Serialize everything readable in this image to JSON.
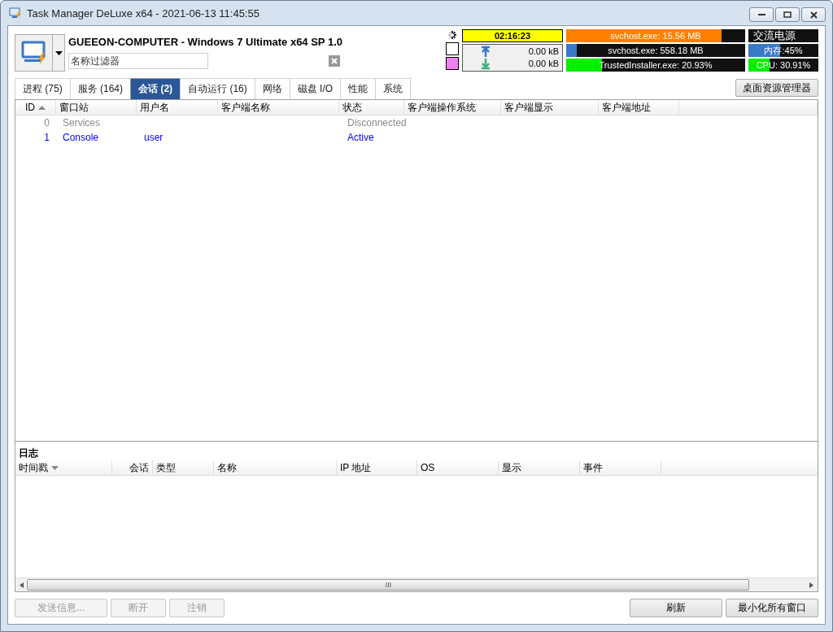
{
  "window": {
    "title": "Task Manager DeLuxe x64 - 2021-06-13 11:45:55"
  },
  "header": {
    "computer": "GUEEON-COMPUTER - Windows 7 Ultimate x64 SP 1.0",
    "filter": {
      "placeholder": "名称过滤器"
    }
  },
  "status": {
    "uptime": "02:16:23",
    "net_up": "0.00 kB",
    "net_down": "0.00 kB",
    "meters": [
      {
        "text": "svchost.exe: 15.56 MB",
        "level": 0.87,
        "color": "#ff8000"
      },
      {
        "text": "交流电源"
      },
      {
        "text": "svchost.exe: 558.18 MB",
        "level": 0.06,
        "color": "#3a78c8"
      },
      {
        "text": "内存:45%",
        "level": 0.45,
        "color": "#3a78c8"
      },
      {
        "text": "TrustedInstaller.exe: 20.93%",
        "level": 0.2,
        "color": "#00f000"
      },
      {
        "text": "CPU: 30.91%",
        "level": 0.3,
        "color": "#00f000"
      }
    ]
  },
  "tabs": [
    {
      "label": "进程 (75)",
      "selected": false
    },
    {
      "label": "服务 (164)",
      "selected": false
    },
    {
      "label": "会话 (2)",
      "selected": true
    },
    {
      "label": "自动运行 (16)",
      "selected": false
    },
    {
      "label": "网络",
      "selected": false
    },
    {
      "label": "磁盘 I/O",
      "selected": false
    },
    {
      "label": "性能",
      "selected": false
    },
    {
      "label": "系统",
      "selected": false
    }
  ],
  "desktop_button": "桌面资源管理器",
  "table": {
    "columns": [
      {
        "label": "ID",
        "sort_up": true
      },
      {
        "label": "窗口站"
      },
      {
        "label": "用户名"
      },
      {
        "label": "客户端名称"
      },
      {
        "label": "状态"
      },
      {
        "label": "客户端操作系统"
      },
      {
        "label": "客户端显示"
      },
      {
        "label": "客户端地址"
      }
    ],
    "rows": [
      {
        "id": "0",
        "station": "Services",
        "state": "Disconnected",
        "disabled": true
      },
      {
        "id": "1",
        "station": "Console",
        "user": "user",
        "state": "Active",
        "disabled": false
      }
    ]
  },
  "log": {
    "title": "日志",
    "columns": [
      {
        "label": "时间戳",
        "sort_down": true
      },
      {
        "label": "会话"
      },
      {
        "label": "类型"
      },
      {
        "label": "名称"
      },
      {
        "label": "IP 地址"
      },
      {
        "label": "OS"
      },
      {
        "label": "显示"
      },
      {
        "label": "事件"
      }
    ]
  },
  "buttons_left": [
    {
      "label": "发送信息...",
      "disabled": true
    },
    {
      "label": "断开",
      "disabled": true
    },
    {
      "label": "注销",
      "disabled": true
    }
  ],
  "buttons_right": [
    {
      "label": "刷新",
      "disabled": false
    },
    {
      "label": "最小化所有窗口",
      "disabled": false
    }
  ]
}
